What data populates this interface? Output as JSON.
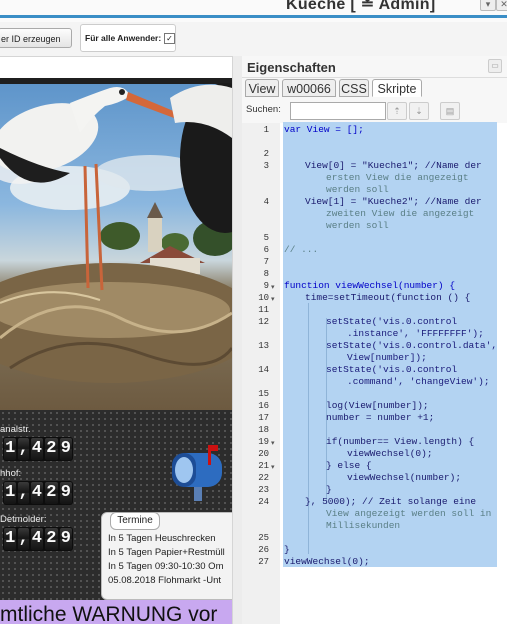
{
  "window": {
    "title": "Kueche [ ≗ Admin]"
  },
  "toolbar": {
    "id_button_label": "er ID erzeugen",
    "all_users_label": "Für alle Anwender:",
    "all_users_checked": "✓"
  },
  "preview": {
    "counters": [
      {
        "label": "analstr.",
        "digits": [
          "1",
          ",",
          "4",
          "2",
          "9"
        ]
      },
      {
        "label": "hhof:",
        "digits": [
          "1",
          ",",
          "4",
          "2",
          "9"
        ]
      },
      {
        "label": "Detmolder:",
        "digits": [
          "1",
          ",",
          "4",
          "2",
          "9"
        ]
      }
    ],
    "termine": {
      "title": "Termine",
      "lines": [
        "In 5 Tagen Heuschrecken",
        "In 5 Tagen Papier+Restmüll",
        "In 5 Tagen 09:30-10:30 Om",
        "05.08.2018 Flohmarkt -Unt"
      ]
    },
    "warning_text": "mtliche WARNUNG vor"
  },
  "properties": {
    "title": "Eigenschaften",
    "tabs": [
      "View",
      "w00066",
      "CSS",
      "Skripte"
    ],
    "active_tab": "Skripte",
    "search_label": "Suchen:",
    "search_value": "",
    "line_numbers": [
      "1",
      "2",
      "3",
      "4",
      "5",
      "6",
      "7",
      "8",
      "9",
      "10",
      "11",
      "12",
      "13",
      "14",
      "15",
      "16",
      "17",
      "18",
      "19",
      "20",
      "21",
      "22",
      "23",
      "24",
      "25",
      "26",
      "27"
    ],
    "code_text": [
      "var View = [];",
      "View[0] = \"Kueche1\"; //Name der",
      "ersten View die angezeigt",
      "werden soll",
      "View[1] = \"Kueche2\"; //Name der",
      "zweiten View die angezeigt",
      "werden soll",
      "// ...",
      "function viewWechsel(number) {",
      "time=setTimeout(function () {",
      "setState('vis.0.control",
      ".instance', 'FFFFFFFF');",
      "setState('vis.0.control.data',",
      "View[number]);",
      "setState('vis.0.control",
      ".command', 'changeView');",
      "log(View[number]);",
      "number = number +1;",
      "if(number== View.length) {",
      "viewWechsel(0);",
      "} else {",
      "viewWechsel(number);",
      "}",
      "}, 5000); // Zeit solange eine",
      "View angezeigt werden soll in",
      "Millisekunden",
      "}",
      "viewWechsel(0);"
    ]
  }
}
